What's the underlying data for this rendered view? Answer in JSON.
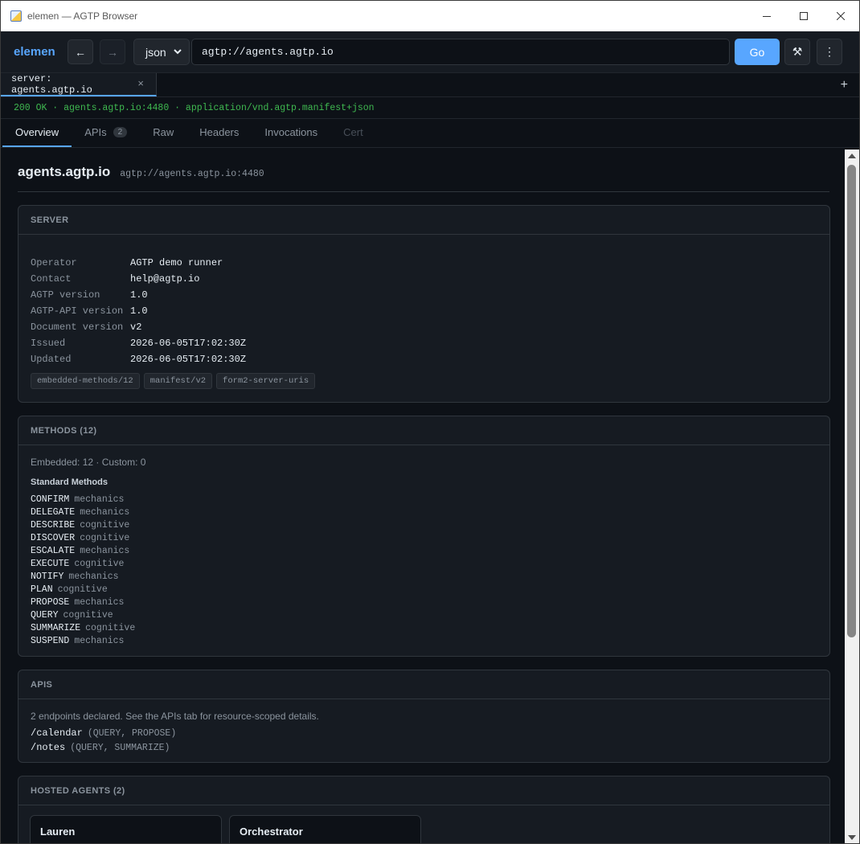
{
  "window": {
    "title": "elemen — AGTP Browser",
    "minimize_icon": "minimize-icon",
    "maximize_icon": "maximize-icon",
    "close_icon": "close-icon"
  },
  "toolbar": {
    "brand": "elemen",
    "back_glyph": "←",
    "forward_glyph": "→",
    "format_selected": "json",
    "url": "agtp://agents.agtp.io",
    "go_label": "Go",
    "tools_glyph": "⚒",
    "menu_glyph": "⋮"
  },
  "tabs": [
    {
      "label": "server: agents.agtp.io",
      "close": "×"
    }
  ],
  "tab_add": "+",
  "status_line": "200 OK · agents.agtp.io:4480 · application/vnd.agtp.manifest+json",
  "subtabs": [
    {
      "label": "Overview"
    },
    {
      "label": "APIs",
      "count": "2"
    },
    {
      "label": "Raw"
    },
    {
      "label": "Headers"
    },
    {
      "label": "Invocations"
    },
    {
      "label": "Cert"
    }
  ],
  "page": {
    "host": "agents.agtp.io",
    "host_uri": "agtp://agents.agtp.io:4480"
  },
  "server": {
    "heading": "SERVER",
    "rows": [
      {
        "key": "Operator",
        "value": "AGTP demo runner"
      },
      {
        "key": "Contact",
        "value": "help@agtp.io"
      },
      {
        "key": "AGTP version",
        "value": "1.0"
      },
      {
        "key": "AGTP-API version",
        "value": "1.0"
      },
      {
        "key": "Document version",
        "value": "v2"
      },
      {
        "key": "Issued",
        "value": "2026-06-05T17:02:30Z"
      },
      {
        "key": "Updated",
        "value": "2026-06-05T17:02:30Z"
      }
    ],
    "tags": [
      "embedded-methods/12",
      "manifest/v2",
      "form2-server-uris"
    ]
  },
  "methods": {
    "heading": "METHODS (12)",
    "summary": "Embedded: 12 · Custom: 0",
    "subheading": "Standard Methods",
    "items": [
      {
        "name": "CONFIRM",
        "category": "mechanics"
      },
      {
        "name": "DELEGATE",
        "category": "mechanics"
      },
      {
        "name": "DESCRIBE",
        "category": "cognitive"
      },
      {
        "name": "DISCOVER",
        "category": "cognitive"
      },
      {
        "name": "ESCALATE",
        "category": "mechanics"
      },
      {
        "name": "EXECUTE",
        "category": "cognitive"
      },
      {
        "name": "NOTIFY",
        "category": "mechanics"
      },
      {
        "name": "PLAN",
        "category": "cognitive"
      },
      {
        "name": "PROPOSE",
        "category": "mechanics"
      },
      {
        "name": "QUERY",
        "category": "cognitive"
      },
      {
        "name": "SUMMARIZE",
        "category": "cognitive"
      },
      {
        "name": "SUSPEND",
        "category": "mechanics"
      }
    ]
  },
  "apis": {
    "heading": "APIS",
    "summary": "2 endpoints declared. See the APIs tab for resource-scoped details.",
    "items": [
      {
        "path": "/calendar",
        "methods": "(QUERY, PROPOSE)"
      },
      {
        "path": "/notes",
        "methods": "(QUERY, SUMMARIZE)"
      }
    ]
  },
  "agents": {
    "heading": "HOSTED AGENTS (2)",
    "items": [
      {
        "name": "Lauren"
      },
      {
        "name": "Orchestrator"
      }
    ]
  },
  "colors": {
    "accent": "#58a6ff",
    "status_ok": "#3fb950",
    "background": "#0d1117",
    "panel": "#161b22"
  }
}
